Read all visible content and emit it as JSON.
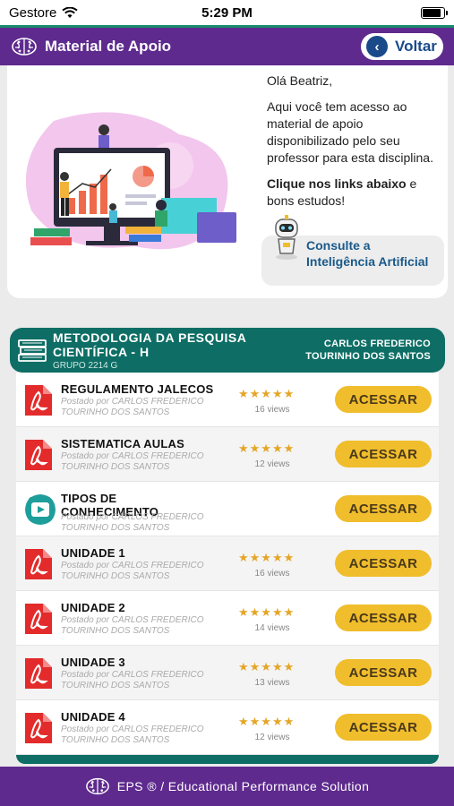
{
  "status": {
    "carrier": "Gestore",
    "time": "5:29 PM"
  },
  "header": {
    "title": "Material de Apoio",
    "back_label": "Voltar"
  },
  "intro": {
    "greeting": "Olá Beatriz,",
    "body": "Aqui você tem acesso ao material de apoio disponibilizado pelo seu professor para esta disciplina.",
    "cta_bold": "Clique nos links abaixo",
    "cta_rest": " e bons estudos!",
    "ai_label": "Consulte a Inteligência Artificial"
  },
  "course": {
    "name": "METODOLOGIA DA PESQUISA CIENTÍFICA - H",
    "group": "GRUPO 2214 G",
    "teacher": "CARLOS FREDERICO TOURINHO DOS SANTOS"
  },
  "materials": [
    {
      "title": "REGULAMENTO JALECOS",
      "posted": "Postado por CARLOS FREDERICO TOURINHO DOS SANTOS",
      "rating": 5,
      "stars": "★★★★★",
      "views": "16 views",
      "type": "pdf-icon",
      "button": "ACESSAR"
    },
    {
      "title": "SISTEMATICA AULAS",
      "posted": "Postado por CARLOS FREDERICO TOURINHO DOS SANTOS",
      "rating": 5,
      "stars": "★★★★★",
      "views": "12 views",
      "type": "pdf-icon",
      "button": "ACESSAR"
    },
    {
      "title": "TIPOS DE CONHECIMENTO",
      "posted": "Postado por CARLOS FREDERICO TOURINHO DOS SANTOS",
      "rating": 0,
      "stars": "",
      "views": "",
      "type": "video-icon",
      "button": "ACESSAR"
    },
    {
      "title": "UNIDADE 1",
      "posted": "Postado por CARLOS FREDERICO TOURINHO DOS SANTOS",
      "rating": 5,
      "stars": "★★★★★",
      "views": "16 views",
      "type": "pdf-icon",
      "button": "ACESSAR"
    },
    {
      "title": "UNIDADE 2",
      "posted": "Postado por CARLOS FREDERICO TOURINHO DOS SANTOS",
      "rating": 5,
      "stars": "★★★★★",
      "views": "14 views",
      "type": "pdf-icon",
      "button": "ACESSAR"
    },
    {
      "title": "UNIDADE 3",
      "posted": "Postado por CARLOS FREDERICO TOURINHO DOS SANTOS",
      "rating": 5,
      "stars": "★★★★★",
      "views": "13 views",
      "type": "pdf-icon",
      "button": "ACESSAR"
    },
    {
      "title": "UNIDADE 4",
      "posted": "Postado por CARLOS FREDERICO TOURINHO DOS SANTOS",
      "rating": 5,
      "stars": "★★★★★",
      "views": "12 views",
      "type": "pdf-icon",
      "button": "ACESSAR"
    }
  ],
  "footer": {
    "text": "EPS ® / Educational Performance Solution"
  },
  "colors": {
    "purple": "#5e2a8e",
    "teal": "#0e6e65",
    "button": "#f0bd2c",
    "pdf": "#e32b2b",
    "star": "#e5a526"
  }
}
